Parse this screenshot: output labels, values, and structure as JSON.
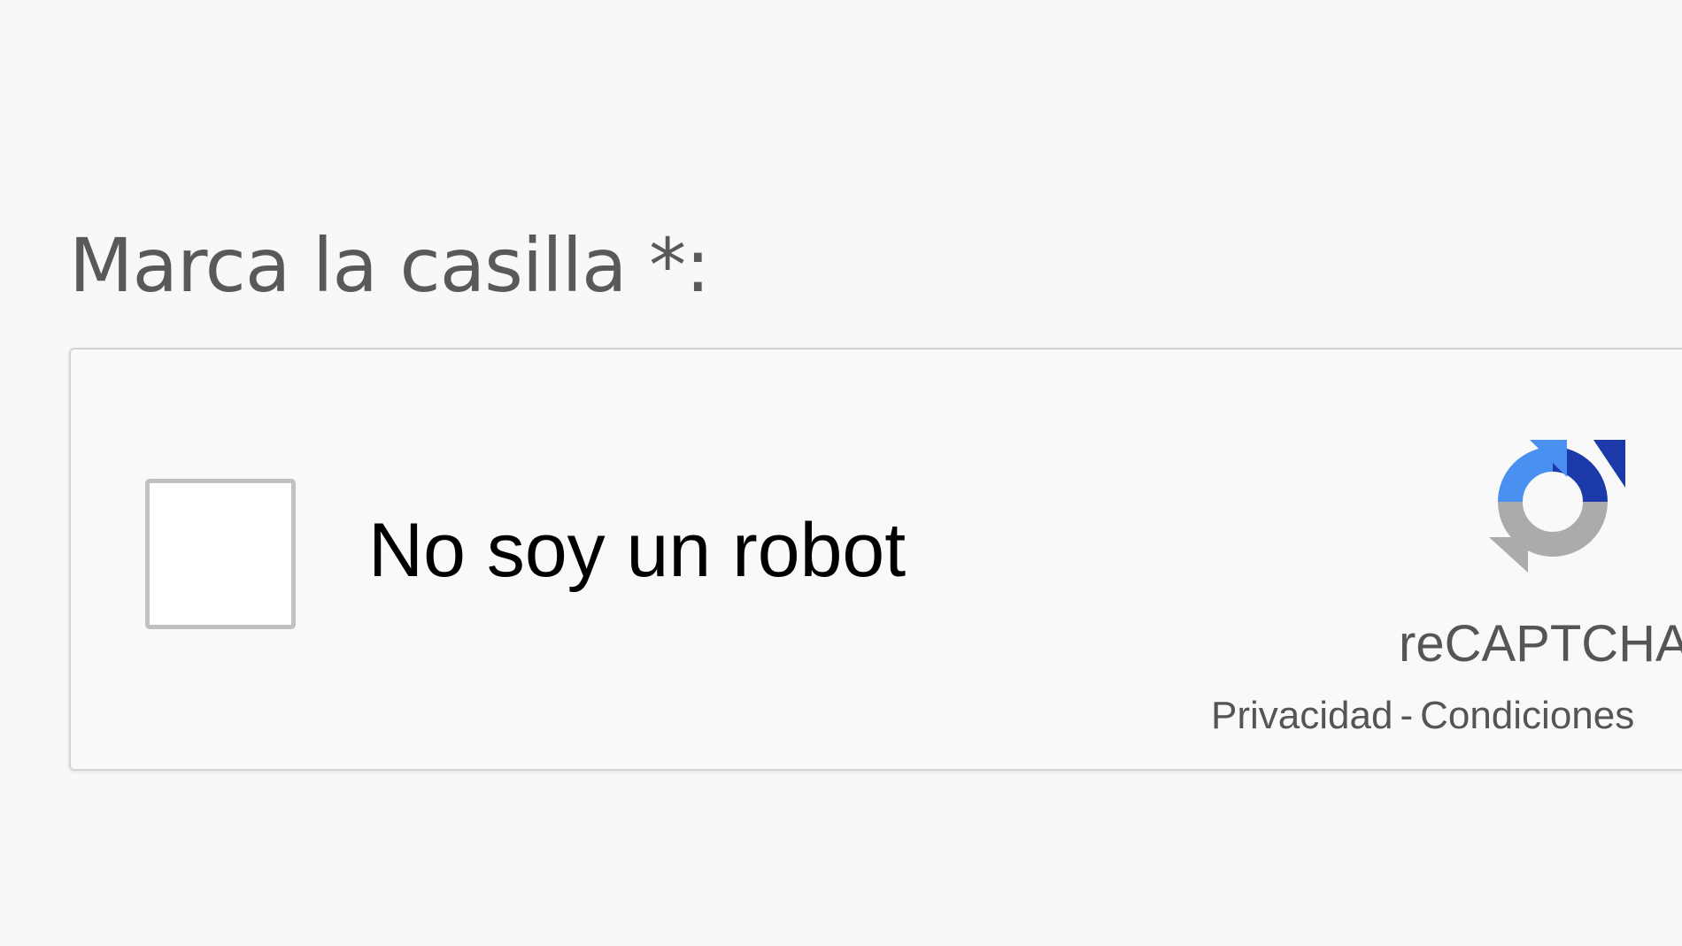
{
  "form": {
    "label": "Marca la casilla *:"
  },
  "captcha": {
    "checkbox_label": "No soy un robot",
    "checked": false,
    "brand_name": "reCAPTCHA",
    "privacy_link": "Privacidad",
    "separator": "-",
    "terms_link": "Condiciones",
    "logo_icon": "recaptcha-logo-icon",
    "colors": {
      "logo_light_blue": "#4A90F0",
      "logo_dark_blue": "#1C3AA9",
      "logo_gray": "#ABABAB",
      "label_text": "#595959",
      "checkbox_border": "#C1C1C1"
    }
  }
}
